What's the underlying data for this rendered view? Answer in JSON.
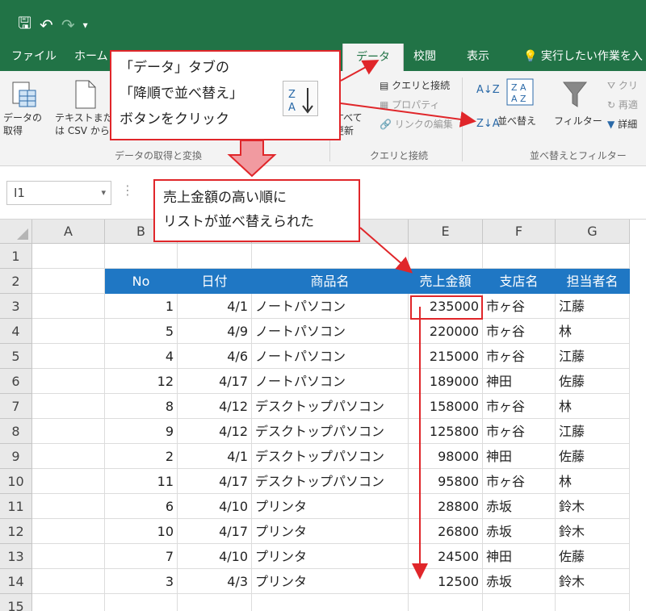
{
  "qat": {
    "save_icon": "save-icon",
    "undo_icon": "undo-icon",
    "redo_icon": "redo-icon"
  },
  "tabs": [
    {
      "label": "ファイル",
      "active": false
    },
    {
      "label": "ホーム",
      "active": false
    },
    {
      "label": "データ",
      "active": true
    },
    {
      "label": "校閲",
      "active": false
    },
    {
      "label": "表示",
      "active": false
    },
    {
      "label": "実行したい作業を入",
      "active": false
    }
  ],
  "ribbon": {
    "get_data": "データの\n取得",
    "from_csv": "テキストまた\nは CSV から",
    "group_get_transform": "データの取得と変換",
    "refresh_all": "すべて\n更新",
    "queries_connections": "クエリと接続",
    "properties": "プロパティ",
    "edit_links": "リンクの編集",
    "group_queries": "クエリと接続",
    "sort": "並べ替え",
    "filter": "フィルター",
    "clear": "クリ",
    "reapply": "再適",
    "advanced": "詳細",
    "group_sort_filter": "並べ替えとフィルター"
  },
  "namebox": {
    "value": "I1"
  },
  "callout1": {
    "line1": "「データ」タブの",
    "line2": "「降順で並べ替え」",
    "line3": "ボタンをクリック"
  },
  "callout2": {
    "line1": "売上金額の高い順に",
    "line2": "リストが並べ替えられた"
  },
  "columns": [
    "A",
    "B",
    "C",
    "D",
    "E",
    "F",
    "G"
  ],
  "rows": [
    "1",
    "2",
    "3",
    "4",
    "5",
    "6",
    "7",
    "8",
    "9",
    "10",
    "11",
    "12",
    "13",
    "14",
    "15"
  ],
  "table": {
    "headers": [
      "No",
      "日付",
      "商品名",
      "売上金額",
      "支店名",
      "担当者名"
    ],
    "rows": [
      [
        "1",
        "4/1",
        "ノートパソコン",
        "235000",
        "市ヶ谷",
        "江藤"
      ],
      [
        "5",
        "4/9",
        "ノートパソコン",
        "220000",
        "市ヶ谷",
        "林"
      ],
      [
        "4",
        "4/6",
        "ノートパソコン",
        "215000",
        "市ヶ谷",
        "江藤"
      ],
      [
        "12",
        "4/17",
        "ノートパソコン",
        "189000",
        "神田",
        "佐藤"
      ],
      [
        "8",
        "4/12",
        "デスクトップパソコン",
        "158000",
        "市ヶ谷",
        "林"
      ],
      [
        "9",
        "4/12",
        "デスクトップパソコン",
        "125800",
        "市ヶ谷",
        "江藤"
      ],
      [
        "2",
        "4/1",
        "デスクトップパソコン",
        "98000",
        "神田",
        "佐藤"
      ],
      [
        "11",
        "4/17",
        "デスクトップパソコン",
        "95800",
        "市ヶ谷",
        "林"
      ],
      [
        "6",
        "4/10",
        "プリンタ",
        "28800",
        "赤坂",
        "鈴木"
      ],
      [
        "10",
        "4/17",
        "プリンタ",
        "26800",
        "赤坂",
        "鈴木"
      ],
      [
        "7",
        "4/10",
        "プリンタ",
        "24500",
        "神田",
        "佐藤"
      ],
      [
        "3",
        "4/3",
        "プリンタ",
        "12500",
        "赤坂",
        "鈴木"
      ]
    ]
  },
  "colors": {
    "excel_green": "#217346",
    "header_blue": "#1f77c4",
    "annotation_red": "#e0262a"
  }
}
